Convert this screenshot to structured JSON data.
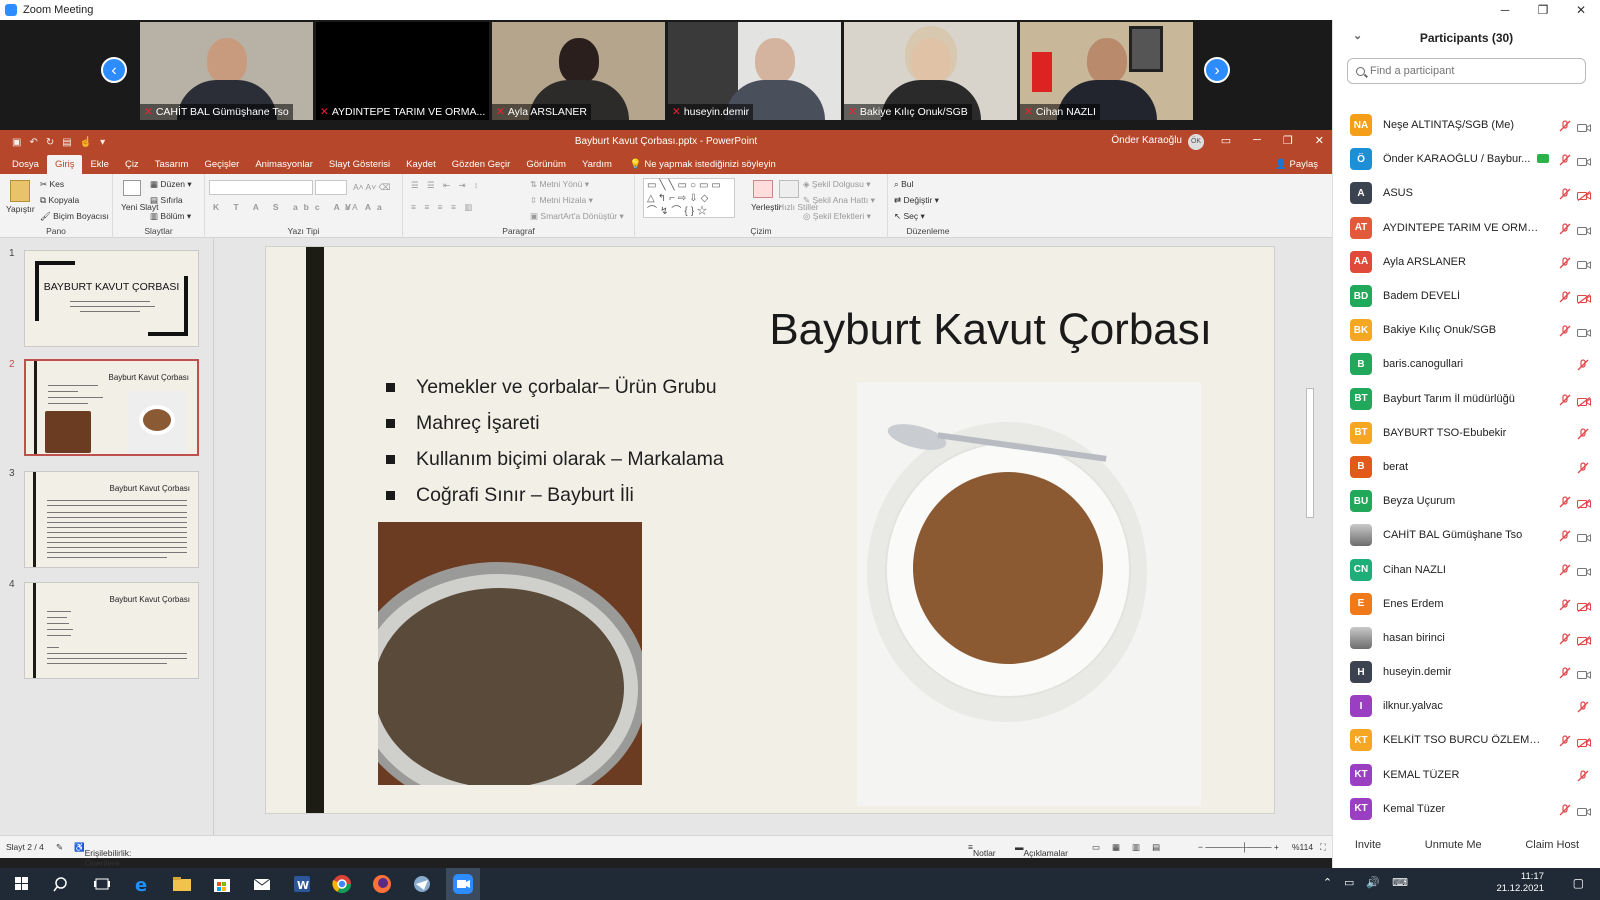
{
  "zoom": {
    "window_title": "Zoom Meeting",
    "window_controls": {
      "minimize": "─",
      "restore": "❐",
      "close": "✕"
    },
    "videos": [
      {
        "name": "CAHİT BAL Gümüşhane Tso"
      },
      {
        "name": "AYDINTEPE TARIM VE ORMA..."
      },
      {
        "name": "Ayla ARSLANER"
      },
      {
        "name": "huseyin.demir"
      },
      {
        "name": "Bakiye Kılıç Onuk/SGB"
      },
      {
        "name": "Cihan NAZLI"
      }
    ]
  },
  "powerpoint": {
    "document_title": "Bayburt Kavut Çorbası.pptx  -  PowerPoint",
    "user": "Önder Karaoğlu",
    "user_initials": "ÖK",
    "tabs": [
      "Dosya",
      "Giriş",
      "Ekle",
      "Çiz",
      "Tasarım",
      "Geçişler",
      "Animasyonlar",
      "Slayt Gösterisi",
      "Kaydet",
      "Gözden Geçir",
      "Görünüm",
      "Yardım"
    ],
    "active_tab": "Giriş",
    "tell_me": "Ne yapmak istediğinizi söyleyin",
    "share": "Paylaş",
    "ribbon": {
      "clipboard": {
        "paste": "Yapıştır",
        "cut": "Kes",
        "copy": "Kopyala",
        "format_painter": "Biçim Boyacısı",
        "group": "Pano"
      },
      "slides": {
        "new_slide": "Yeni Slayt",
        "layout": "Düzen",
        "reset": "Sıfırla",
        "section": "Bölüm",
        "group": "Slaytlar"
      },
      "font": {
        "group": "Yazı Tipi"
      },
      "paragraph": {
        "text_direction": "Metni Yönü",
        "align_text": "Metni Hizala",
        "smartart": "SmartArt'a Dönüştür",
        "group": "Paragraf"
      },
      "drawing": {
        "arrange": "Yerleştir",
        "quick_styles": "Hızlı Stiller",
        "shape_fill": "Şekil Dolgusu",
        "shape_outline": "Şekil Ana Hattı",
        "shape_effects": "Şekil Efektleri",
        "group": "Çizim"
      },
      "editing": {
        "find": "Bul",
        "replace": "Değiştir",
        "select": "Seç",
        "group": "Düzenleme"
      }
    },
    "thumbnails": [
      {
        "num": "1",
        "title": "BAYBURT KAVUT ÇORBASI"
      },
      {
        "num": "2",
        "title": "Bayburt Kavut Çorbası"
      },
      {
        "num": "3",
        "title": "Bayburt Kavut Çorbası"
      },
      {
        "num": "4",
        "title": "Bayburt Kavut Çorbası"
      }
    ],
    "slide": {
      "title": "Bayburt Kavut Çorbası",
      "bullets": [
        "Yemekler ve çorbalar– Ürün Grubu",
        "Mahreç İşareti",
        "Kullanım biçimi olarak – Markalama",
        "Coğrafi Sınır – Bayburt İli"
      ]
    },
    "status": {
      "slide_counter": "Slayt 2 / 4",
      "accessibility": "Erişilebilirlik: Önerilere göz atın",
      "notes": "Notlar",
      "comments": "Açıklamalar",
      "zoom": "%114"
    }
  },
  "participants": {
    "title": "Participants (30)",
    "search_placeholder": "Find a participant",
    "list": [
      {
        "initials": "NA",
        "name": "Neşe ALTINTAŞ/SGB (Me)",
        "color": "#f59e1a",
        "cam": "on"
      },
      {
        "initials": "Ö",
        "name": "Önder KARAOĞLU / Baybur...",
        "color": "#1d8fd6",
        "cam": "on",
        "share": true
      },
      {
        "initials": "A",
        "name": "ASUS",
        "color": "#3b4250",
        "cam": "off"
      },
      {
        "initials": "AT",
        "name": "AYDINTEPE TARIM VE ORMAN ...",
        "color": "#e25a3a",
        "cam": "on"
      },
      {
        "initials": "AA",
        "name": "Ayla ARSLANER",
        "color": "#e04a3a",
        "cam": "on"
      },
      {
        "initials": "BD",
        "name": "Badem DEVELİ",
        "color": "#22a85a",
        "cam": "off"
      },
      {
        "initials": "BK",
        "name": "Bakiye Kılıç Onuk/SGB",
        "color": "#f5a623",
        "cam": "on"
      },
      {
        "initials": "B",
        "name": "baris.canogullari",
        "color": "#22a85a",
        "cam": "none"
      },
      {
        "initials": "BT",
        "name": "Bayburt Tarım İl müdürlüğü",
        "color": "#22a85a",
        "cam": "off"
      },
      {
        "initials": "BT",
        "name": "BAYBURT TSO-Ebubekir",
        "color": "#f5a623",
        "cam": "none"
      },
      {
        "initials": "B",
        "name": "berat",
        "color": "#e25a1a",
        "cam": "none"
      },
      {
        "initials": "BU",
        "name": "Beyza Uçurum",
        "color": "#22a85a",
        "cam": "off"
      },
      {
        "initials": "",
        "name": "CAHİT BAL Gümüşhane Tso",
        "color": "#8a8f98",
        "cam": "on",
        "photo": true
      },
      {
        "initials": "CN",
        "name": "Cihan NAZLI",
        "color": "#1fae7a",
        "cam": "on"
      },
      {
        "initials": "E",
        "name": "Enes Erdem",
        "color": "#f07a1a",
        "cam": "off"
      },
      {
        "initials": "",
        "name": "hasan birinci",
        "color": "#9a9a9a",
        "cam": "off",
        "photo": true
      },
      {
        "initials": "H",
        "name": "huseyin.demir",
        "color": "#3b4250",
        "cam": "on"
      },
      {
        "initials": "I",
        "name": "ilknur.yalvac",
        "color": "#9b3fc2",
        "cam": "none"
      },
      {
        "initials": "KT",
        "name": "KELKİT TSO BURCU ÖZLEM SU...",
        "color": "#f5a623",
        "cam": "off"
      },
      {
        "initials": "KT",
        "name": "KEMAL TÜZER",
        "color": "#9b3fc2",
        "cam": "none"
      },
      {
        "initials": "KT",
        "name": "Kemal Tüzer",
        "color": "#9b3fc2",
        "cam": "on"
      }
    ],
    "buttons": {
      "invite": "Invite",
      "unmute": "Unmute Me",
      "claim": "Claim Host"
    }
  },
  "taskbar": {
    "time": "11:17",
    "date": "21.12.2021"
  }
}
